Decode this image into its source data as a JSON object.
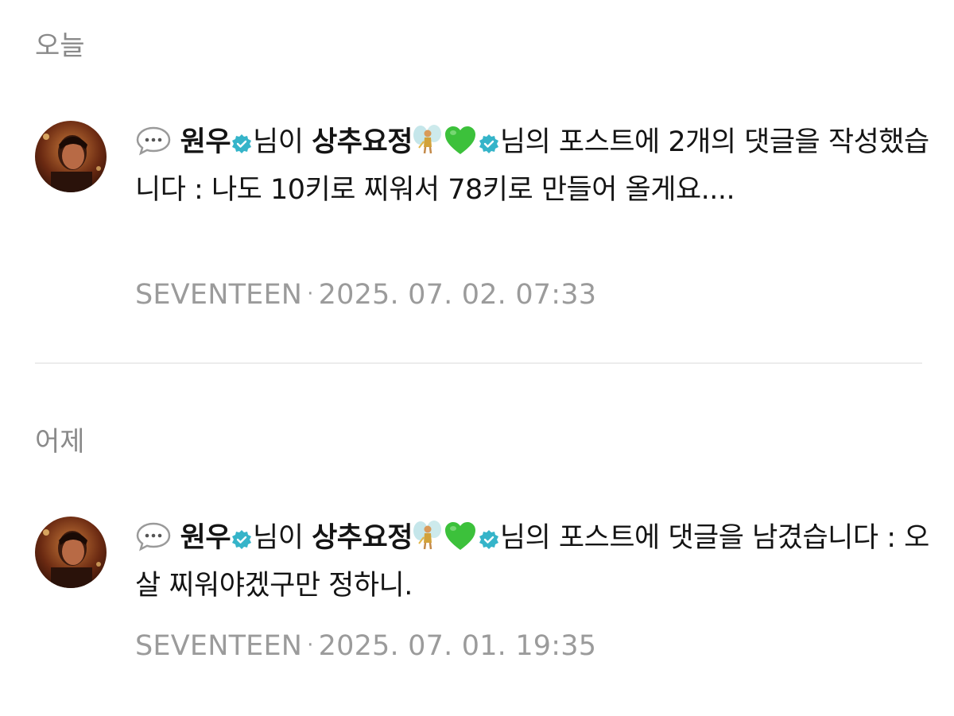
{
  "sections": [
    {
      "header": "오늘",
      "notification": {
        "user": "원우",
        "particle_user": "님이",
        "target": "상추요정",
        "rest": "님의 포스트에 2개의 댓글을 작성했습니다 : 나도 10키로 찌워서 78키로 만들어 올게요....",
        "community": "SEVENTEEN",
        "separator": "·",
        "timestamp": "2025. 07. 02. 07:33"
      }
    },
    {
      "header": "어제",
      "notification": {
        "user": "원우",
        "particle_user": "님이",
        "target": "상추요정",
        "rest": "님의 포스트에 댓글을 남겼습니다 : 오 살 찌워야겠구만 정하니.",
        "community": "SEVENTEEN",
        "separator": "·",
        "timestamp": "2025. 07. 01. 19:35"
      }
    }
  ],
  "icons": {
    "comment": "speech-bubble-icon",
    "verified": "verified-badge-icon",
    "fairy": "fairy-emoji-icon",
    "heart": "green-heart-emoji-icon"
  },
  "colors": {
    "verified": "#35b4c9",
    "heart": "#3cc13b",
    "meta": "#9b9b9b",
    "header": "#8a8a8a"
  }
}
